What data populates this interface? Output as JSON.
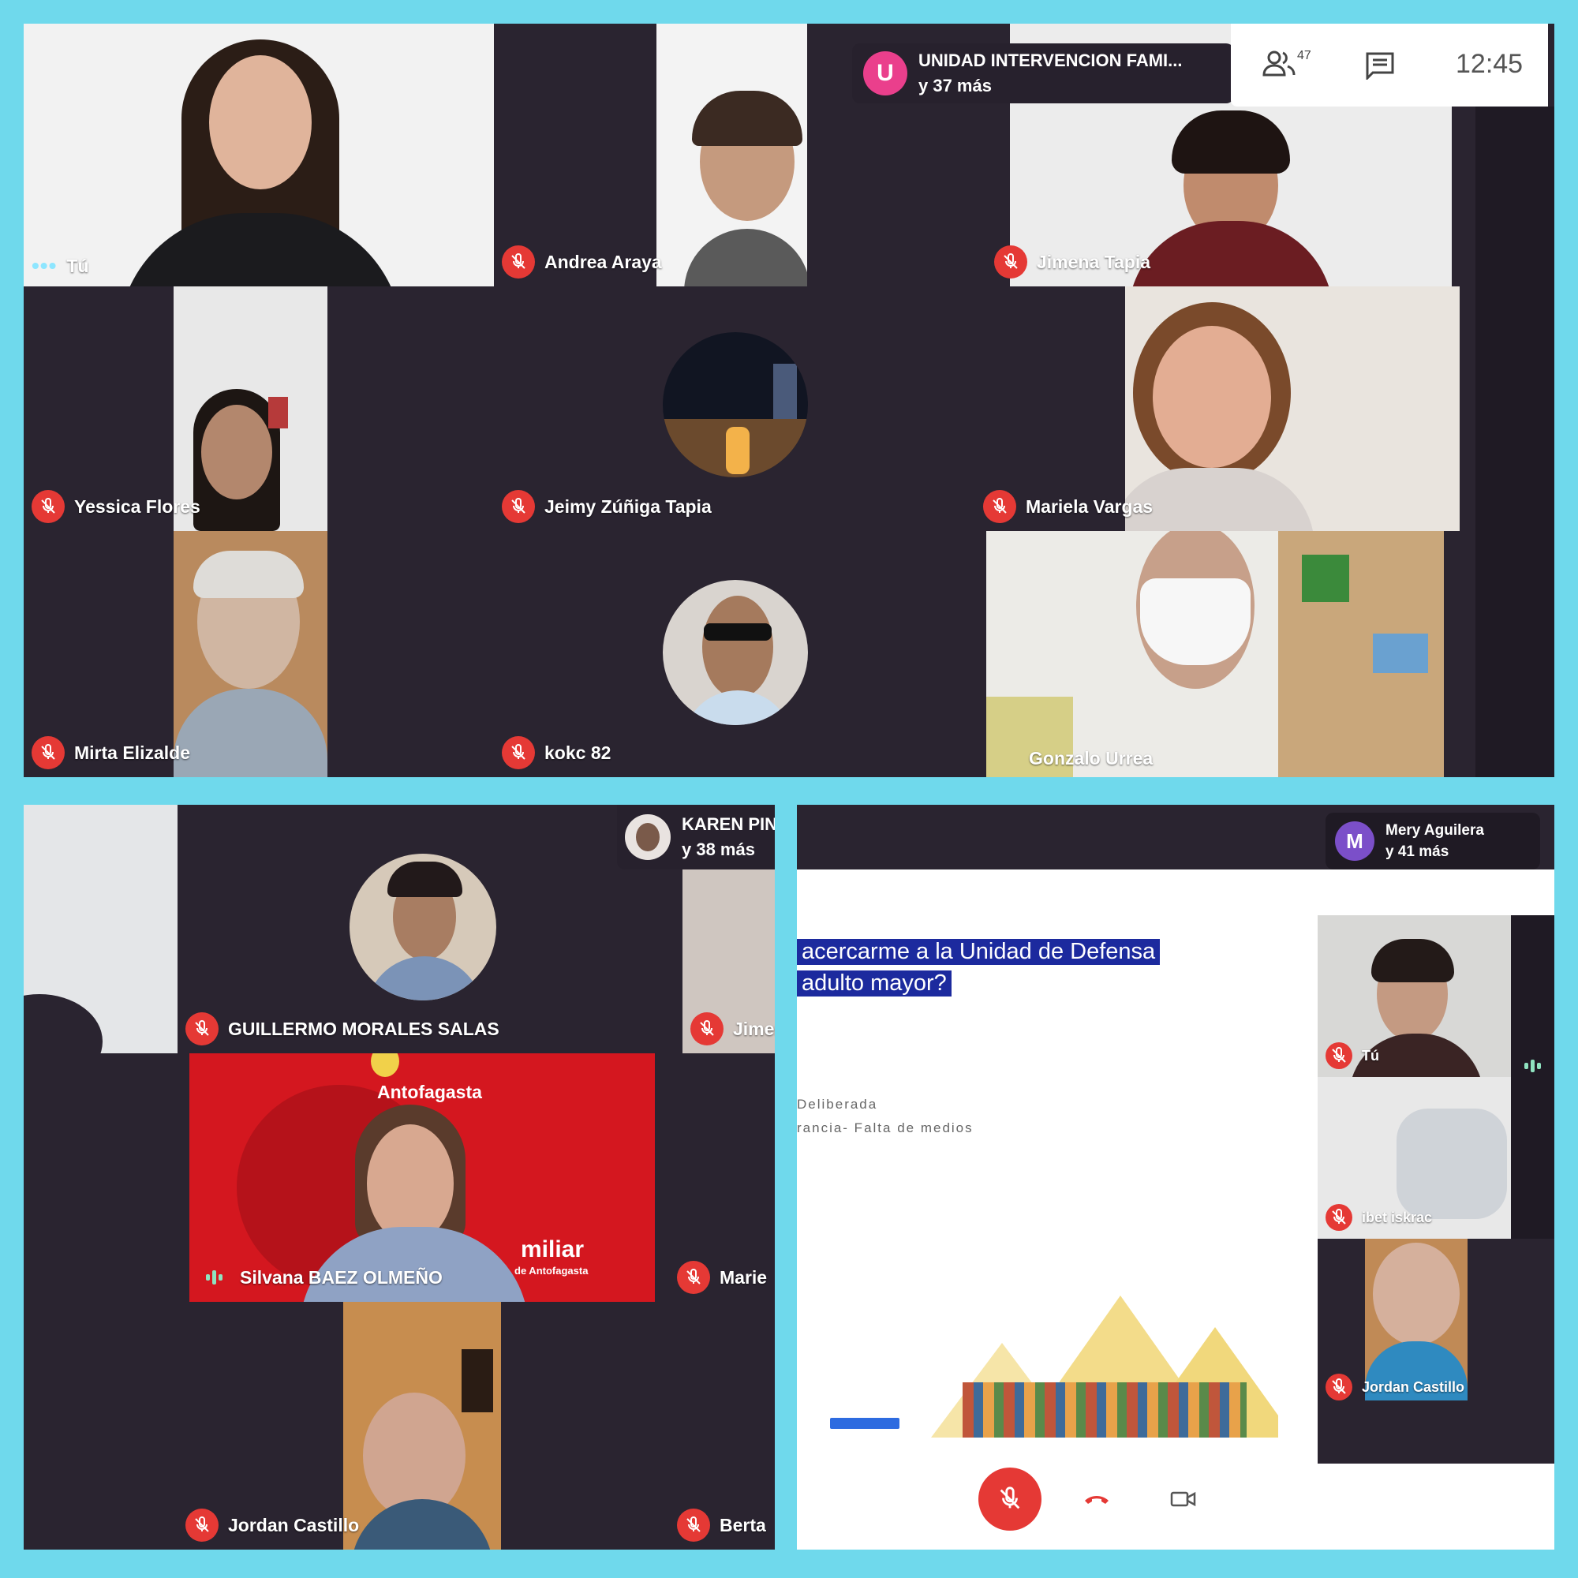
{
  "meeting1": {
    "host_initial": "U",
    "host_name": "UNIDAD INTERVENCION FAMI...",
    "host_more": "y 37 más",
    "participants_count": "47",
    "clock": "12:45",
    "tiles": [
      {
        "label": "Tú",
        "state": "speaking-dots"
      },
      {
        "label": "Andrea Araya",
        "state": "muted"
      },
      {
        "label": "Jimena Tapia",
        "state": "muted"
      },
      {
        "label": "Yessica Flores",
        "state": "muted"
      },
      {
        "label": "Jeimy Zúñiga Tapia",
        "state": "muted"
      },
      {
        "label": "Mariela Vargas",
        "state": "muted"
      },
      {
        "label": "Mirta Elizalde",
        "state": "muted"
      },
      {
        "label": "kokc 82",
        "state": "muted"
      },
      {
        "label": "Gonzalo Urrea",
        "state": "none"
      }
    ]
  },
  "meeting2": {
    "host_name": "KAREN PIN",
    "host_more": "y 38 más",
    "tiles": [
      {
        "label": "GUILLERMO MORALES SALAS",
        "state": "muted"
      },
      {
        "label": "Jimen",
        "state": "muted"
      },
      {
        "label": "Silvana BAEZ OLMEÑO",
        "state": "speaking"
      },
      {
        "label": "Marie",
        "state": "muted"
      },
      {
        "label": "Jordan Castillo",
        "state": "muted"
      },
      {
        "label": "Berta",
        "state": "muted"
      }
    ],
    "banner_title": "Antofagasta",
    "banner_sub": "miliar",
    "banner_sub2": "de Antofagasta"
  },
  "meeting3": {
    "host_initial": "M",
    "host_name": "Mery Aguilera",
    "host_more": "y 41 más",
    "slide_line1": "acercarme a la Unidad de Defensa",
    "slide_line2": "adulto mayor?",
    "slide_small1": "Deliberada",
    "slide_small2": "rancia- Falta de medios",
    "tiles": [
      {
        "label": "Tú",
        "state": "muted"
      },
      {
        "label": "ibet iskrac",
        "state": "muted"
      },
      {
        "label": "Jordan Castillo",
        "state": "muted"
      }
    ]
  },
  "icons": {
    "mic_off": "mic-off-icon",
    "people": "people-icon",
    "chat": "chat-icon",
    "hangup": "hangup-icon",
    "camera": "camera-icon"
  },
  "colors": {
    "frame": "#6fd9ec",
    "tile_bg": "#2a2430",
    "muted": "#e53935",
    "host_u": "#ea3f8c",
    "host_m": "#7b4fc9"
  }
}
